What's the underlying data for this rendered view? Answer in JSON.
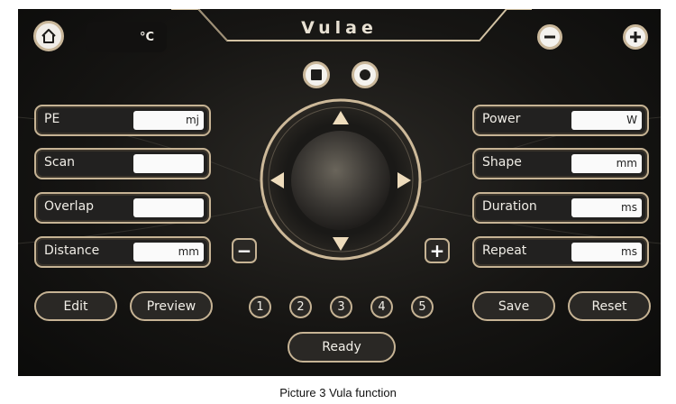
{
  "app": {
    "title": "Vulae",
    "temperature_unit": "°C"
  },
  "header": {
    "home_icon": "home-icon",
    "decrease_icon": "minus-icon",
    "increase_icon": "plus-icon"
  },
  "controls": {
    "stop_icon": "stop-icon",
    "record_icon": "record-icon"
  },
  "left_params": [
    {
      "label": "PE",
      "value": "",
      "unit": "mj"
    },
    {
      "label": "Scan",
      "value": "",
      "unit": ""
    },
    {
      "label": "Overlap",
      "value": "",
      "unit": ""
    },
    {
      "label": "Distance",
      "value": "",
      "unit": "mm"
    }
  ],
  "right_params": [
    {
      "label": "Power",
      "value": "",
      "unit": "W"
    },
    {
      "label": "Shape",
      "value": "",
      "unit": "mm"
    },
    {
      "label": "Duration",
      "value": "",
      "unit": "ms"
    },
    {
      "label": "Repeat",
      "value": "",
      "unit": "ms"
    }
  ],
  "joystick": {
    "up_icon": "arrow-up-icon",
    "down_icon": "arrow-down-icon",
    "left_icon": "arrow-left-icon",
    "right_icon": "arrow-right-icon",
    "minus_label": "−",
    "plus_label": "+"
  },
  "presets": [
    "1",
    "2",
    "3",
    "4",
    "5"
  ],
  "buttons": {
    "edit": "Edit",
    "preview": "Preview",
    "save": "Save",
    "reset": "Reset",
    "ready": "Ready"
  },
  "colors": {
    "accent": "#c6b394",
    "panel": "#161513",
    "field": "#fafafa"
  },
  "caption": "Picture 3 Vula function"
}
